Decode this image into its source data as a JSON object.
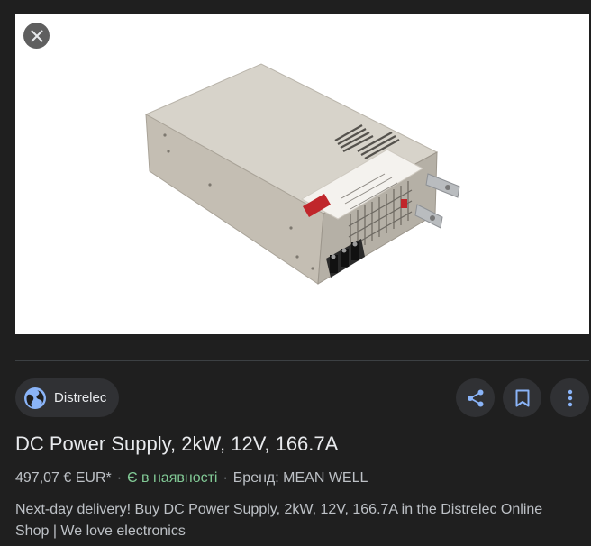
{
  "product": {
    "image_alt": "MEAN WELL RSP-2400-24 power supply",
    "title": "DC Power Supply, 2kW, 12V, 166.7A",
    "price": "497,07 € EUR*",
    "availability": "Є в наявності",
    "brand": "Бренд: MEAN WELL",
    "separator": "·",
    "description": "Next-day delivery! Buy DC Power Supply, 2kW, 12V, 166.7A in the Distrelec Online Shop | We love electronics",
    "label_model": "RSP-2400-24",
    "logo_text": "MW"
  },
  "source": {
    "name": "Distrelec",
    "icon": "globe-icon"
  },
  "actions": {
    "close_icon": "close-icon",
    "share_icon": "share-icon",
    "bookmark_icon": "bookmark-icon",
    "more_icon": "more-vert-icon"
  },
  "colors": {
    "background": "#1f1f1f",
    "chip": "#303134",
    "accent_blue": "#8ab4f8",
    "in_stock_green": "#81c995"
  }
}
